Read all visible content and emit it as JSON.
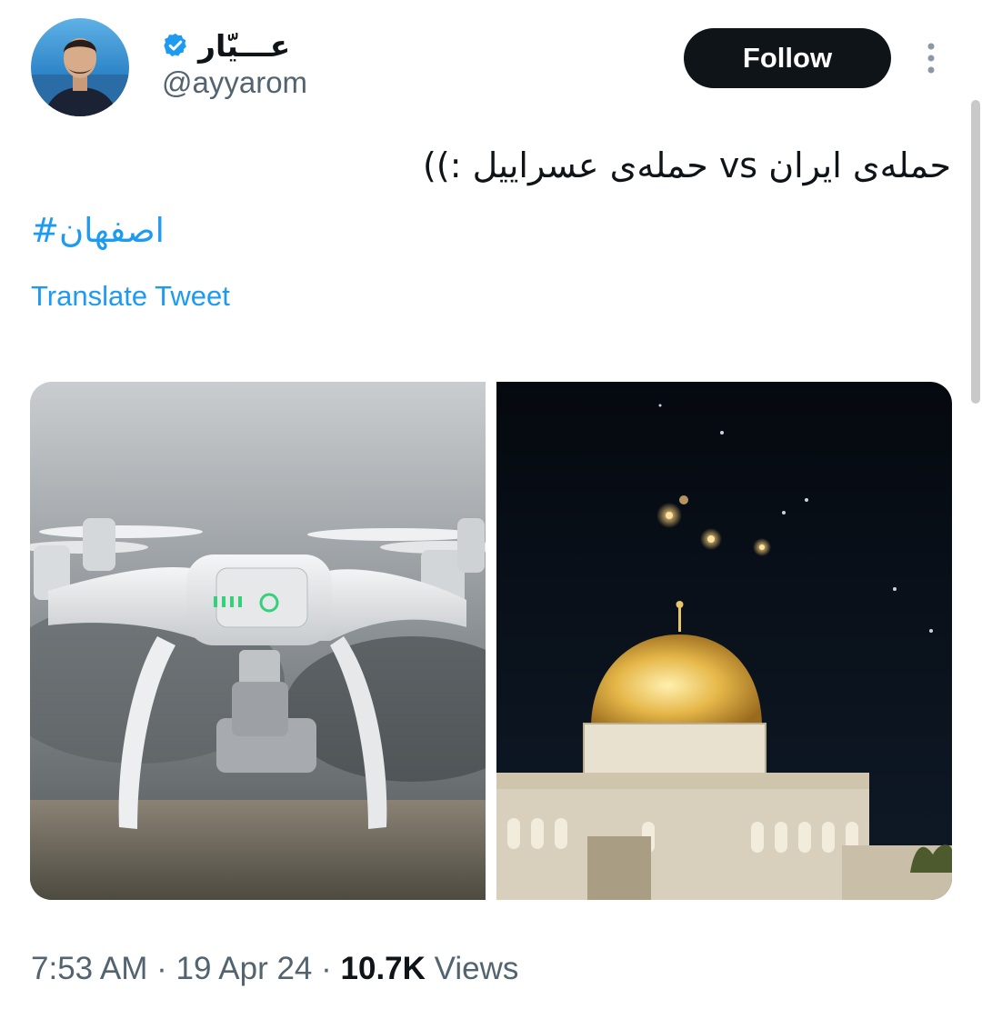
{
  "author": {
    "display_name": "عـــیّار",
    "handle": "@ayyarom",
    "verified_icon": "verified-badge-icon",
    "avatar_icon": "avatar-photo"
  },
  "actions": {
    "follow_label": "Follow",
    "more_icon": "more-options-icon"
  },
  "tweet": {
    "text": "حمله‌ی ایران vs حمله‌ی عسراییل :))",
    "hashtag": "اصفهان#",
    "translate_label": "Translate Tweet"
  },
  "media": {
    "images": [
      {
        "icon": "drone-photo"
      },
      {
        "icon": "dome-of-the-rock-night-photo"
      }
    ]
  },
  "meta": {
    "time": "7:53 AM",
    "separator": "·",
    "date": "19 Apr 24",
    "views_count": "10.7K",
    "views_label": "Views"
  },
  "colors": {
    "accent": "#1d9bf0",
    "text_primary": "#0f1419",
    "text_secondary": "#536471",
    "button_bg": "#0f1419"
  }
}
